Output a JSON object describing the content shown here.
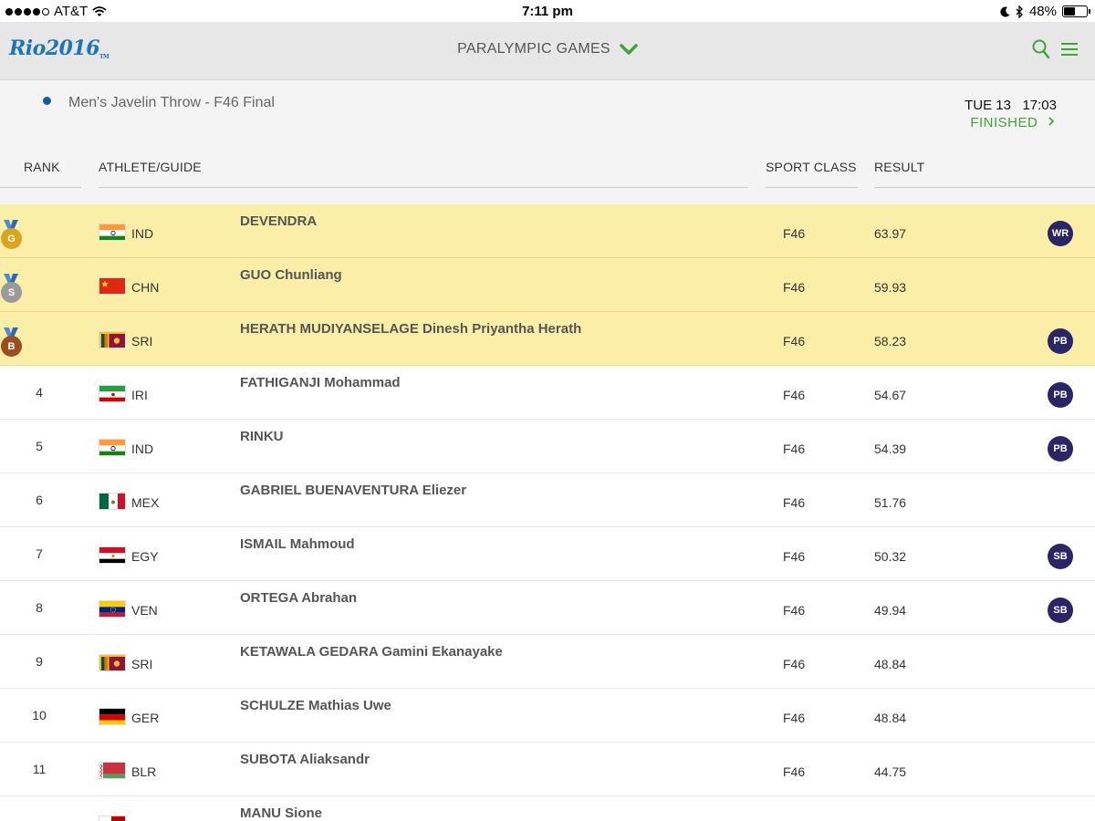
{
  "status_bar": {
    "carrier": "AT&T",
    "time": "7:11 pm",
    "battery": "48%",
    "battery_level": 0.48
  },
  "header": {
    "logo": "Rio2016",
    "logo_tm": "TM",
    "title": "PARALYMPIC GAMES"
  },
  "event": {
    "title": "Men's Javelin Throw - F46 Final",
    "date": "TUE 13",
    "time": "17:03",
    "status": "FINISHED"
  },
  "columns": {
    "rank": "RANK",
    "athlete": "ATHLETE/GUIDE",
    "sport_class": "SPORT CLASS",
    "result": "RESULT"
  },
  "colors": {
    "gold": "#d9a420",
    "silver": "#9a9a9a",
    "bronze": "#9a4e22",
    "record_badge": "#2a2566",
    "accent_green": "#3fa535",
    "medal_row": "#fbefa8"
  },
  "results": [
    {
      "rank": "",
      "medal": "G",
      "medal_type": "gold",
      "flag": "ind",
      "noc": "IND",
      "athlete": "DEVENDRA",
      "class": "F46",
      "result": "63.97",
      "record": "WR"
    },
    {
      "rank": "",
      "medal": "S",
      "medal_type": "silver",
      "flag": "chn",
      "noc": "CHN",
      "athlete": "GUO Chunliang",
      "class": "F46",
      "result": "59.93",
      "record": ""
    },
    {
      "rank": "",
      "medal": "B",
      "medal_type": "bronze",
      "flag": "sri",
      "noc": "SRI",
      "athlete": "HERATH MUDIYANSELAGE Dinesh Priyantha Herath",
      "class": "F46",
      "result": "58.23",
      "record": "PB"
    },
    {
      "rank": "4",
      "medal": "",
      "medal_type": "",
      "flag": "iri",
      "noc": "IRI",
      "athlete": "FATHIGANJI Mohammad",
      "class": "F46",
      "result": "54.67",
      "record": "PB"
    },
    {
      "rank": "5",
      "medal": "",
      "medal_type": "",
      "flag": "ind",
      "noc": "IND",
      "athlete": "RINKU",
      "class": "F46",
      "result": "54.39",
      "record": "PB"
    },
    {
      "rank": "6",
      "medal": "",
      "medal_type": "",
      "flag": "mex",
      "noc": "MEX",
      "athlete": "GABRIEL BUENAVENTURA Eliezer",
      "class": "F46",
      "result": "51.76",
      "record": ""
    },
    {
      "rank": "7",
      "medal": "",
      "medal_type": "",
      "flag": "egy",
      "noc": "EGY",
      "athlete": "ISMAIL Mahmoud",
      "class": "F46",
      "result": "50.32",
      "record": "SB"
    },
    {
      "rank": "8",
      "medal": "",
      "medal_type": "",
      "flag": "ven",
      "noc": "VEN",
      "athlete": "ORTEGA Abrahan",
      "class": "F46",
      "result": "49.94",
      "record": "SB"
    },
    {
      "rank": "9",
      "medal": "",
      "medal_type": "",
      "flag": "sri",
      "noc": "SRI",
      "athlete": "KETAWALA GEDARA Gamini Ekanayake",
      "class": "F46",
      "result": "48.84",
      "record": ""
    },
    {
      "rank": "10",
      "medal": "",
      "medal_type": "",
      "flag": "ger",
      "noc": "GER",
      "athlete": "SCHULZE Mathias Uwe",
      "class": "F46",
      "result": "48.84",
      "record": ""
    },
    {
      "rank": "11",
      "medal": "",
      "medal_type": "",
      "flag": "blr",
      "noc": "BLR",
      "athlete": "SUBOTA Aliaksandr",
      "class": "F46",
      "result": "44.75",
      "record": ""
    },
    {
      "rank": "",
      "medal": "",
      "medal_type": "",
      "flag": "tga",
      "noc": "",
      "athlete": "MANU Sione",
      "class": "",
      "result": "",
      "record": ""
    }
  ]
}
